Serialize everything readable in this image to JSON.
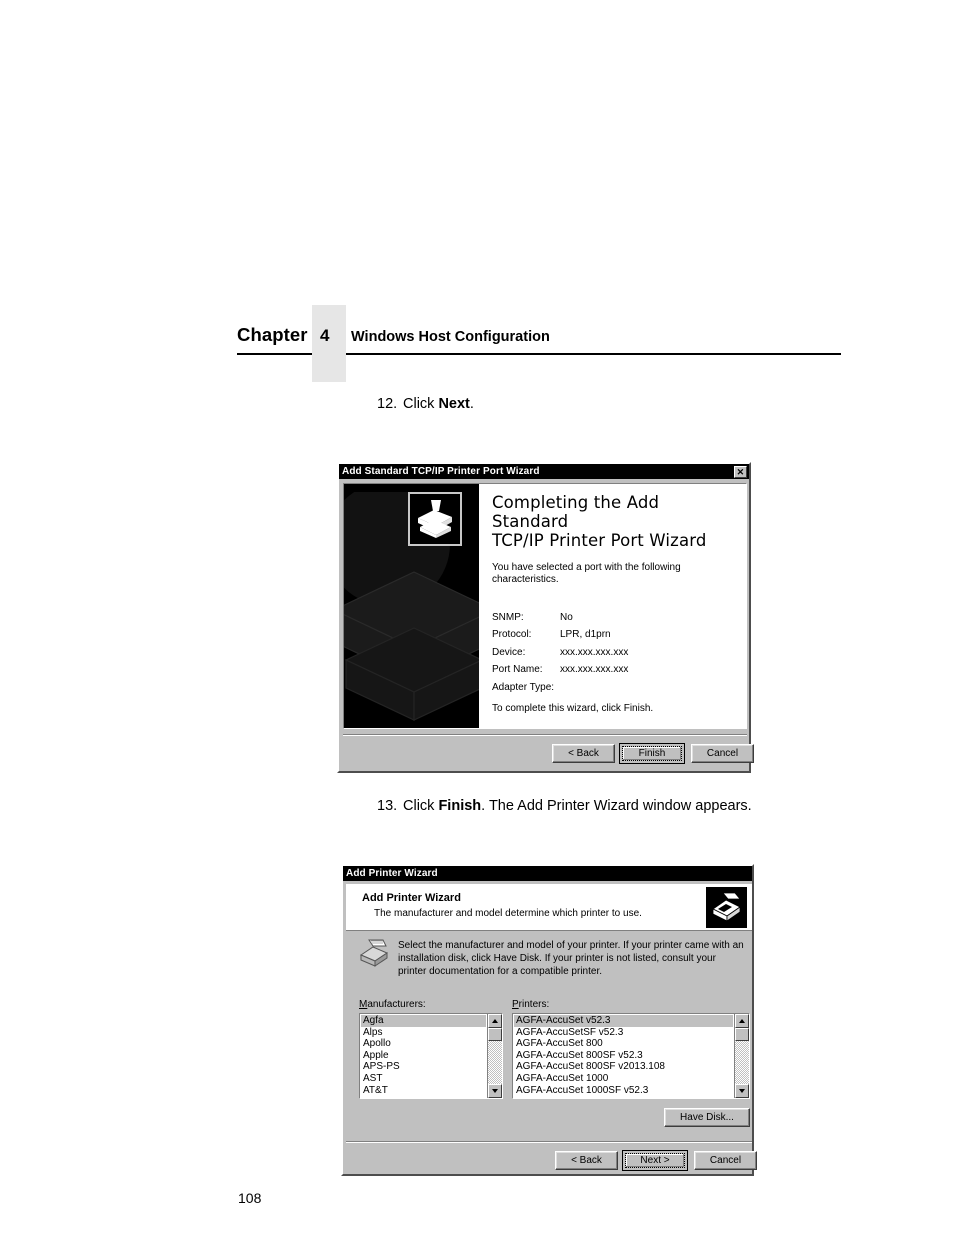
{
  "page": {
    "chapter_word": "Chapter",
    "chapter_number": "4",
    "chapter_title": "Windows Host Configuration",
    "page_number": "108"
  },
  "steps": {
    "step12": {
      "number": "12.",
      "text_before": "Click ",
      "bold": "Next",
      "text_after": "."
    },
    "step13": {
      "number": "13.",
      "text_before": "Click ",
      "bold": "Finish",
      "text_after": ". The Add Printer Wizard window appears."
    }
  },
  "tcpip_wizard": {
    "titlebar": "Add Standard TCP/IP Printer Port Wizard",
    "close_label": "✕",
    "heading_line1": "Completing the Add Standard",
    "heading_line2": "TCP/IP Printer Port Wizard",
    "subtitle": "You have selected a port with the following characteristics.",
    "characteristics": [
      {
        "label": "SNMP:",
        "value": "No"
      },
      {
        "label": "Protocol:",
        "value": "LPR, d1prn"
      },
      {
        "label": "Device:",
        "value": "xxx.xxx.xxx.xxx"
      },
      {
        "label": "Port Name:",
        "value": "xxx.xxx.xxx.xxx"
      },
      {
        "label": "Adapter Type:",
        "value": ""
      }
    ],
    "footnote": "To complete this wizard, click Finish.",
    "buttons": {
      "back": "< Back",
      "finish": "Finish",
      "cancel": "Cancel"
    }
  },
  "add_printer_wizard": {
    "titlebar": "Add Printer Wizard",
    "banner_title": "Add Printer Wizard",
    "banner_subtitle": "The manufacturer and model determine which printer to use.",
    "note": "Select the manufacturer and model of your printer. If your printer came with an installation disk, click Have Disk. If your printer is not listed, consult your printer documentation for a compatible printer.",
    "manufacturers_label": "Manufacturers:",
    "printers_label": "Printers:",
    "manufacturers": [
      "Agfa",
      "Alps",
      "Apollo",
      "Apple",
      "APS-PS",
      "AST",
      "AT&T"
    ],
    "manufacturers_selected": "Agfa",
    "printers": [
      "AGFA-AccuSet v52.3",
      "AGFA-AccuSetSF v52.3",
      "AGFA-AccuSet 800",
      "AGFA-AccuSet 800SF v52.3",
      "AGFA-AccuSet 800SF v2013.108",
      "AGFA-AccuSet 1000",
      "AGFA-AccuSet 1000SF v52.3"
    ],
    "printers_selected": "AGFA-AccuSet v52.3",
    "have_disk_button": "Have Disk...",
    "buttons": {
      "back": "< Back",
      "next": "Next >",
      "cancel": "Cancel"
    }
  },
  "colors": {
    "dialog_face": "#c0c0c0",
    "titlebar": "#000000",
    "chapter_tab": "#e6e6e6",
    "selection": "#c0c0c0"
  }
}
